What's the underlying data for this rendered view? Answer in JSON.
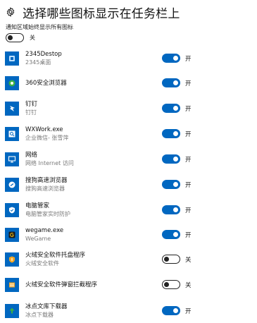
{
  "header": {
    "title": "选择哪些图标显示在任务栏上",
    "icon": "gear-icon"
  },
  "always_show": {
    "label": "通知区域始终显示所有图标",
    "state_label": "关",
    "on": false
  },
  "colors": {
    "accent": "#0067c0",
    "icon_bg": "#0067c0",
    "subtext": "#7a7a7a"
  },
  "apps": [
    {
      "name": "2345Destop",
      "sub": "2345桌面",
      "on": true,
      "state_label": "开",
      "icon": "desktop-app-icon"
    },
    {
      "name": "360安全浏览器",
      "sub": "",
      "on": true,
      "state_label": "开",
      "icon": "browser-360-icon"
    },
    {
      "name": "钉钉",
      "sub": "钉钉",
      "on": true,
      "state_label": "开",
      "icon": "dingtalk-icon"
    },
    {
      "name": "WXWork.exe",
      "sub": "企业微信- 张雪萍",
      "on": true,
      "state_label": "开",
      "icon": "wxwork-icon"
    },
    {
      "name": "网络",
      "sub": "网络 Internet 访问",
      "on": true,
      "state_label": "开",
      "icon": "network-icon"
    },
    {
      "name": "搜狗高速浏览器",
      "sub": "搜狗高速浏览器",
      "on": true,
      "state_label": "开",
      "icon": "sogou-browser-icon"
    },
    {
      "name": "电脑管家",
      "sub": "电脑管家实时防护",
      "on": true,
      "state_label": "开",
      "icon": "shield-icon"
    },
    {
      "name": "wegame.exe",
      "sub": "WeGame",
      "on": true,
      "state_label": "开",
      "icon": "wegame-icon"
    },
    {
      "name": "火绒安全软件托盘程序",
      "sub": "火绒安全软件",
      "on": false,
      "state_label": "关",
      "icon": "huorong-tray-icon"
    },
    {
      "name": "火绒安全软件弹窗拦截程序",
      "sub": "",
      "on": false,
      "state_label": "关",
      "icon": "huorong-popup-icon"
    },
    {
      "name": "冰点文库下载器",
      "sub": "冰点下载器",
      "on": true,
      "state_label": "开",
      "icon": "download-icon"
    }
  ]
}
